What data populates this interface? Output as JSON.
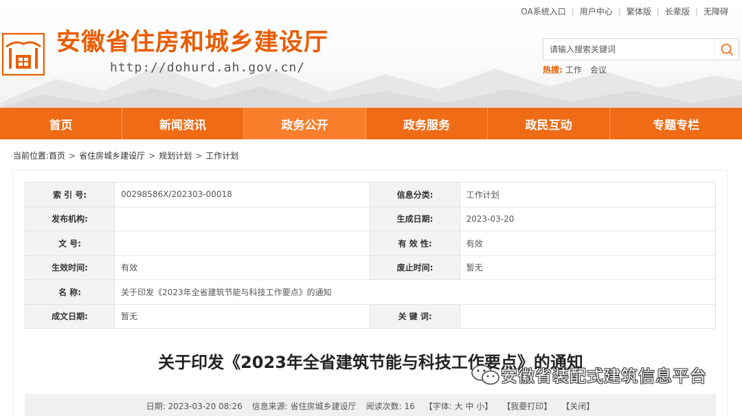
{
  "header": {
    "site_name": "安徽省住房和城乡建设厅",
    "site_url": "http://dohurd.ah.gov.cn/",
    "top_links": [
      "OA系统入口",
      "用户中心",
      "繁体版",
      "长辈版",
      "无障碍"
    ],
    "search": {
      "placeholder": "请输入搜索关键词",
      "value": ""
    },
    "hot": {
      "label": "热搜:",
      "items": [
        "工作",
        "会议"
      ]
    }
  },
  "nav": {
    "items": [
      {
        "label": "首页"
      },
      {
        "label": "新闻资讯"
      },
      {
        "label": "政务公开"
      },
      {
        "label": "政务服务"
      },
      {
        "label": "政民互动"
      },
      {
        "label": "专题专栏"
      }
    ],
    "active_index": 2
  },
  "breadcrumb": {
    "prefix": "当前位置:",
    "items": [
      "首页",
      "省住房城乡建设厅",
      "规划计划",
      "工作计划"
    ],
    "separator": ">"
  },
  "meta_table": {
    "rows": [
      [
        {
          "label": "索 引 号:",
          "value": "00298586X/202303-00018"
        },
        {
          "label": "信息分类:",
          "value": "工作计划"
        }
      ],
      [
        {
          "label": "发布机构:",
          "value": ""
        },
        {
          "label": "生成日期:",
          "value": "2023-03-20"
        }
      ],
      [
        {
          "label": "文 号:",
          "value": ""
        },
        {
          "label": "有 效 性:",
          "value": "有效"
        }
      ],
      [
        {
          "label": "生效时间:",
          "value": "有效"
        },
        {
          "label": "废止时间:",
          "value": "暂无"
        }
      ],
      [
        {
          "label": "名 称:",
          "value": "关于印发《2023年全省建筑节能与科技工作要点》的通知",
          "full": true
        }
      ],
      [
        {
          "label": "成文日期:",
          "value": "暂无"
        },
        {
          "label": "关 键 词:",
          "value": ""
        }
      ]
    ]
  },
  "document": {
    "title": "关于印发《2023年全省建筑节能与科技工作要点》的通知"
  },
  "watermark": {
    "text": "安徽省装配式建筑信息平台"
  },
  "info_bar": {
    "date": "日期:  2023-03-20 08:26",
    "source": "信息来源:  省住房城乡建设厅",
    "views": "阅读次数:  16",
    "font": "【字体:  大 中 小】",
    "print": "【我要打印】",
    "close": "【关闭】"
  },
  "colors": {
    "brand": "#e85d00",
    "nav_bg": "#f06b16",
    "nav_active": "#fa7f2c"
  }
}
